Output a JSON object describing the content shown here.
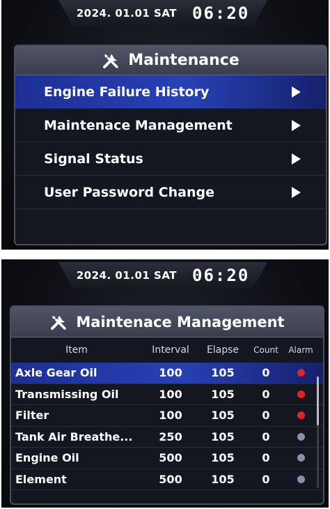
{
  "status": {
    "date": "2024. 01.01 SAT",
    "time": "06:20"
  },
  "maintenance_menu": {
    "title": "Maintenance",
    "items": [
      {
        "label": "Engine Failure History"
      },
      {
        "label": "Maintenace Management"
      },
      {
        "label": "Signal Status"
      },
      {
        "label": "User Password Change"
      }
    ]
  },
  "management": {
    "title": "Maintenace Management",
    "columns": {
      "item": "Item",
      "interval": "Interval",
      "elapse": "Elapse",
      "count": "Count",
      "alarm": "Alarm"
    },
    "rows": [
      {
        "item": "Axle Gear Oil",
        "interval": "100",
        "elapse": "105",
        "count": "0",
        "alarm_color": "#e02424"
      },
      {
        "item": "Transmissing Oil",
        "interval": "100",
        "elapse": "105",
        "count": "0",
        "alarm_color": "#e02424"
      },
      {
        "item": "Filter",
        "interval": "100",
        "elapse": "105",
        "count": "0",
        "alarm_color": "#e02424"
      },
      {
        "item": "Tank Air Breathe...",
        "interval": "250",
        "elapse": "105",
        "count": "0",
        "alarm_color": "#8a8ea6"
      },
      {
        "item": "Engine Oil",
        "interval": "500",
        "elapse": "105",
        "count": "0",
        "alarm_color": "#8a8ea6"
      },
      {
        "item": "Element",
        "interval": "500",
        "elapse": "105",
        "count": "0",
        "alarm_color": "#8a8ea6"
      }
    ]
  },
  "colors": {
    "selection": "#2741b5",
    "alarm_active": "#e02424",
    "alarm_inactive": "#8a8ea6"
  }
}
